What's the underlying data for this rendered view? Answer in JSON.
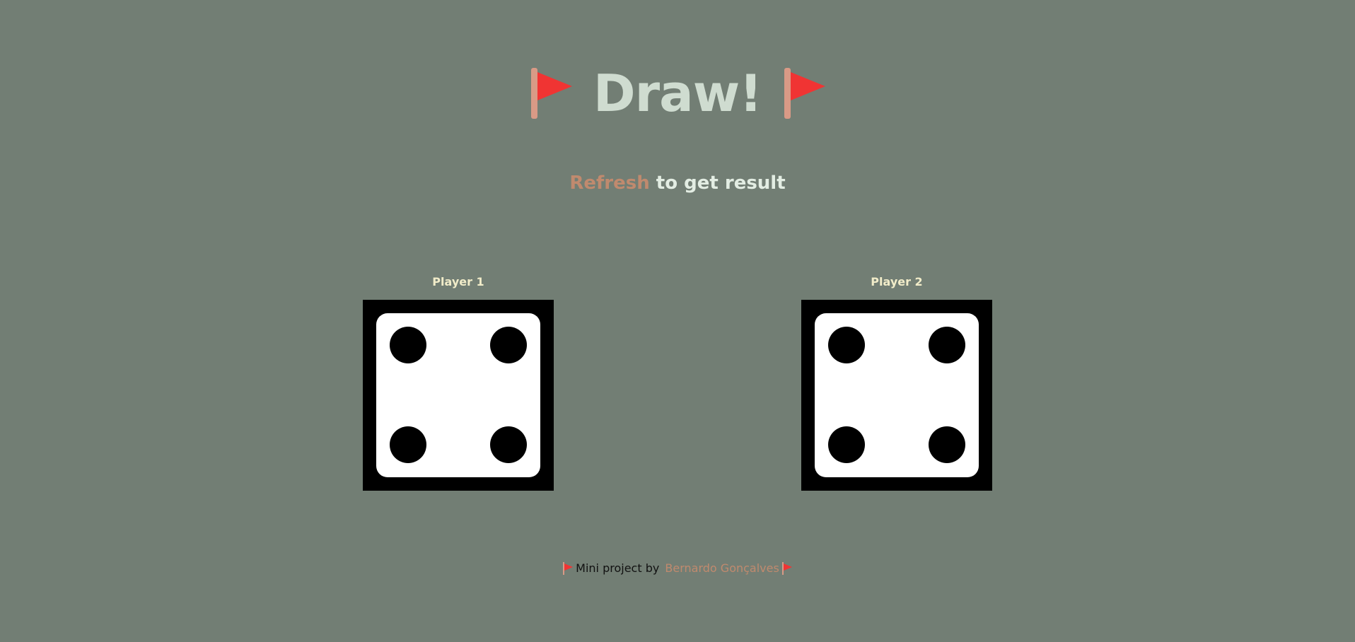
{
  "header": {
    "title": "Draw!",
    "left_icon": "red-flag-icon",
    "right_icon": "red-flag-icon"
  },
  "subtitle": {
    "link_text": "Refresh",
    "rest_text": " to get result"
  },
  "players": [
    {
      "label": "Player 1",
      "die_value": 4
    },
    {
      "label": "Player 2",
      "die_value": 4
    }
  ],
  "footer": {
    "prefix": "Mini project by ",
    "author": "Bernardo Gonçalves"
  },
  "colors": {
    "background": "#727e74",
    "title": "#cfdcd0",
    "accent": "#c08a6e",
    "player_label": "#f1ecc9",
    "flag_red": "#f03433",
    "flag_pole": "#d99a86"
  }
}
